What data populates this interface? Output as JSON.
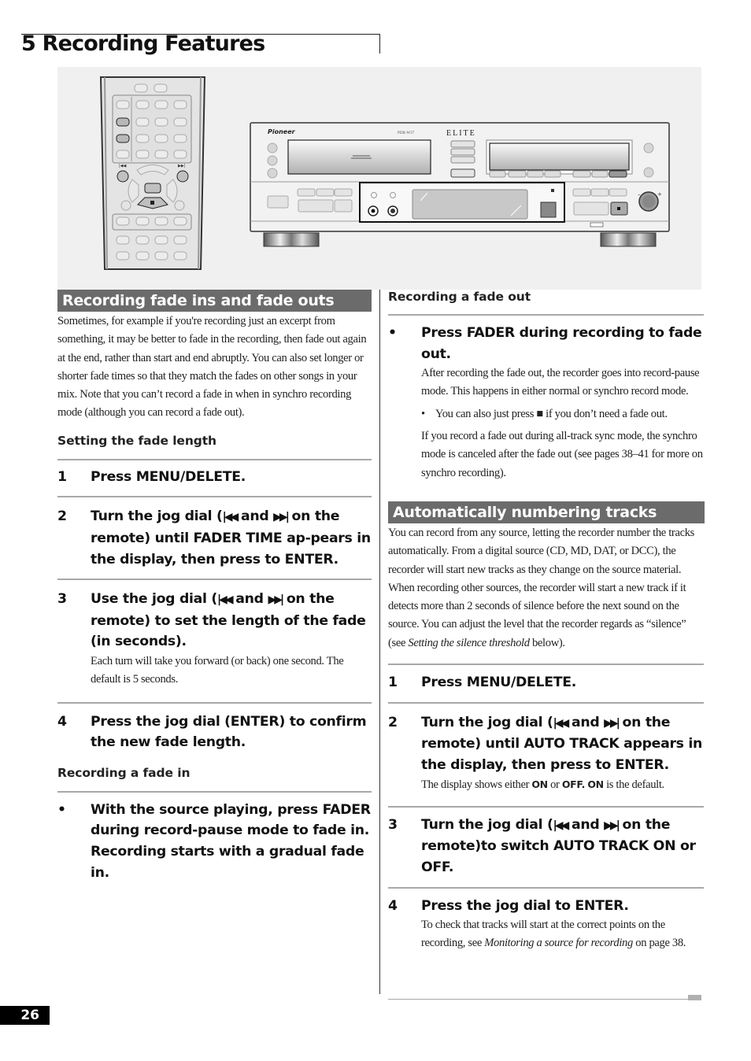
{
  "chapter": {
    "title": "5 Recording Features"
  },
  "illustration": {
    "remote": {
      "prev_label": "|◀◀",
      "next_label": "▶▶|",
      "stop_symbol": "■"
    },
    "deck": {
      "brand": "Pioneer",
      "model": "PDR-W37",
      "series": "ELITE",
      "stop_symbol": "■",
      "minus": "–",
      "plus": "+"
    }
  },
  "left": {
    "section_title": "Recording fade ins and fade outs",
    "intro": "Sometimes, for example if you're recording just an excerpt from something, it may be better to fade in the recording, then fade out again at the end, rather than start and end abruptly. You can also set longer or shorter fade times so that they match the fades on other songs in your mix. Note that you can’t record a fade in when in synchro recording mode (although you can record a fade out).",
    "subhead_length": "Setting the fade length",
    "steps": [
      {
        "num": "1",
        "text": "Press MENU/DELETE."
      },
      {
        "num": "2",
        "text_a": "Turn the jog dial (",
        "sym_prev": "|◀◀",
        "text_b": " and ",
        "sym_next": "▶▶|",
        "text_c": " on the remote) until FADER TIME ap-pears in the display, then press to ENTER."
      },
      {
        "num": "3",
        "text_a": "Use the jog dial (",
        "sym_prev": "|◀◀",
        "text_b": " and ",
        "sym_next": "▶▶|",
        "text_c": " on the remote) to set the length of the fade (in seconds).",
        "note": "Each turn will take you forward (or back) one second. The default is 5 seconds."
      },
      {
        "num": "4",
        "text": "Press the jog dial (ENTER) to confirm the new fade length."
      }
    ],
    "subhead_fade_in": "Recording a fade in",
    "fade_in_bullet": {
      "bullet": "•",
      "text": "With the source playing, press FADER during record-pause mode to fade in. Recording starts with a gradual fade in."
    }
  },
  "right": {
    "subhead_fade_out": "Recording a fade out",
    "fade_out_bullet": {
      "bullet": "•",
      "text": "Press FADER during recording to fade out.",
      "note": "After recording the fade out, the recorder goes into record-pause mode. This happens in either normal or synchro record mode."
    },
    "mini_bullet": {
      "dot": "•",
      "text_a": "You can also just press ",
      "stop": "■",
      "text_b": " if you don’t need a fade out."
    },
    "sync_note": "If you record a fade out during all-track sync mode, the synchro mode is canceled after the fade out (see pages 38–41 for more on synchro recording).",
    "section_title": "Automatically numbering tracks",
    "intro_a": "You can record from any source, letting the recorder number the tracks automatically. From a digital source (CD, MD, DAT, or DCC), the recorder will start new tracks as they change on the source material. When recording other sources, the recorder will start a new track if it detects more than 2 seconds of silence before the next sound on the source. You can adjust the level that the recorder regards as “silence” (see ",
    "intro_italic": "Setting the silence threshold",
    "intro_b": " below).",
    "steps": [
      {
        "num": "1",
        "text": "Press MENU/DELETE."
      },
      {
        "num": "2",
        "text_a": "Turn the jog dial (",
        "sym_prev": "|◀◀",
        "text_b": " and ",
        "sym_next": "▶▶|",
        "text_c": " on the remote) until AUTO TRACK appears in the display, then press to ENTER.",
        "note_a": "The display shows either ",
        "on1": "ON",
        "note_b": " or ",
        "off": "OFF.",
        "note_c": " ",
        "on2": "ON",
        "note_d": " is the default."
      },
      {
        "num": "3",
        "text_a": "Turn the jog dial (",
        "sym_prev": "|◀◀",
        "text_b": " and ",
        "sym_next": "▶▶|",
        "text_c": " on the remote)to switch AUTO TRACK ON or OFF."
      },
      {
        "num": "4",
        "text": "Press the jog dial to ENTER.",
        "note_a": "To check that tracks will start at the correct points on the recording, see ",
        "note_italic": "Monitoring a source for recording",
        "note_b": " on page 38."
      }
    ]
  },
  "footer": {
    "page_number": "26"
  }
}
